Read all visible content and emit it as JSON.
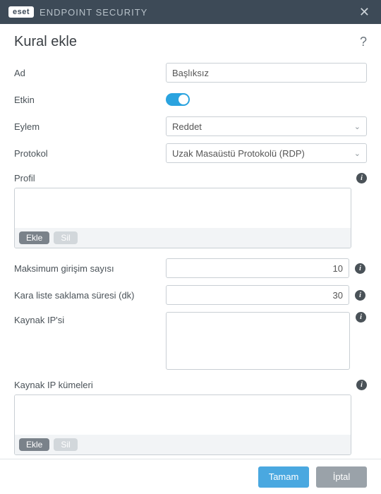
{
  "titlebar": {
    "brand": "eset",
    "appTitle": "ENDPOINT SECURITY"
  },
  "page": {
    "title": "Kural ekle"
  },
  "form": {
    "nameLabel": "Ad",
    "nameValue": "Başlıksız",
    "enabledLabel": "Etkin",
    "actionLabel": "Eylem",
    "actionValue": "Reddet",
    "protocolLabel": "Protokol",
    "protocolValue": "Uzak Masaüstü Protokolü (RDP)",
    "profileLabel": "Profil",
    "maxAttemptsLabel": "Maksimum girişim sayısı",
    "maxAttemptsValue": "10",
    "blacklistRetentionLabel": "Kara liste saklama süresi (dk)",
    "blacklistRetentionValue": "30",
    "sourceIpLabel": "Kaynak IP'si",
    "sourceIpSetsLabel": "Kaynak IP kümeleri"
  },
  "buttons": {
    "add": "Ekle",
    "delete": "Sil",
    "ok": "Tamam",
    "cancel": "İptal"
  }
}
